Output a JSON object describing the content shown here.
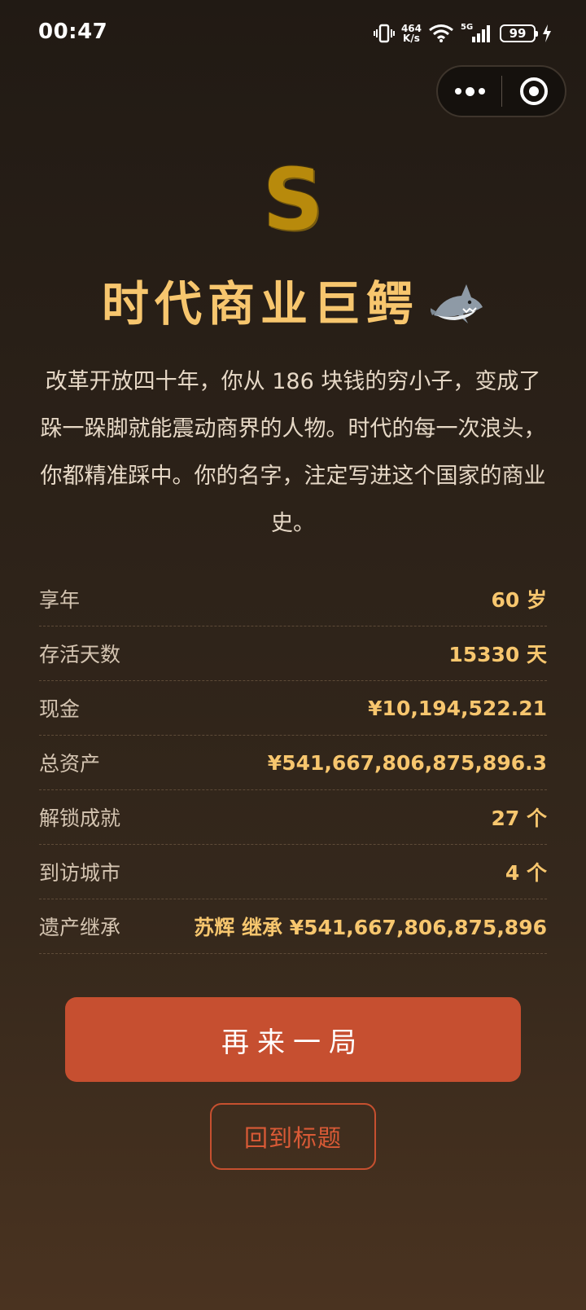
{
  "status_bar": {
    "time": "00:47",
    "net_speed_value": "464",
    "net_speed_unit": "K/s",
    "signal_label": "5G",
    "battery": "99"
  },
  "result": {
    "grade": "S",
    "title": "时代商业巨鳄",
    "title_icon": "shark-icon",
    "description": "改革开放四十年，你从 186 块钱的穷小子，变成了跺一跺脚就能震动商界的人物。时代的每一次浪头，你都精准踩中。你的名字，注定写进这个国家的商业史。"
  },
  "stats": [
    {
      "label": "享年",
      "value": "60 岁"
    },
    {
      "label": "存活天数",
      "value": "15330 天"
    },
    {
      "label": "现金",
      "value": "¥10,194,522.21"
    },
    {
      "label": "总资产",
      "value": "¥541,667,806,875,896.3"
    },
    {
      "label": "解锁成就",
      "value": "27 个"
    },
    {
      "label": "到访城市",
      "value": "4 个"
    },
    {
      "label": "遗产继承",
      "value": "苏辉 继承 ¥541,667,806,875,896"
    }
  ],
  "actions": {
    "restart": "再来一局",
    "back_to_title": "回到标题"
  },
  "colors": {
    "accent_gold": "#f7c66e",
    "primary_button": "#c64f30",
    "grade_gold": "#b88a0c"
  }
}
